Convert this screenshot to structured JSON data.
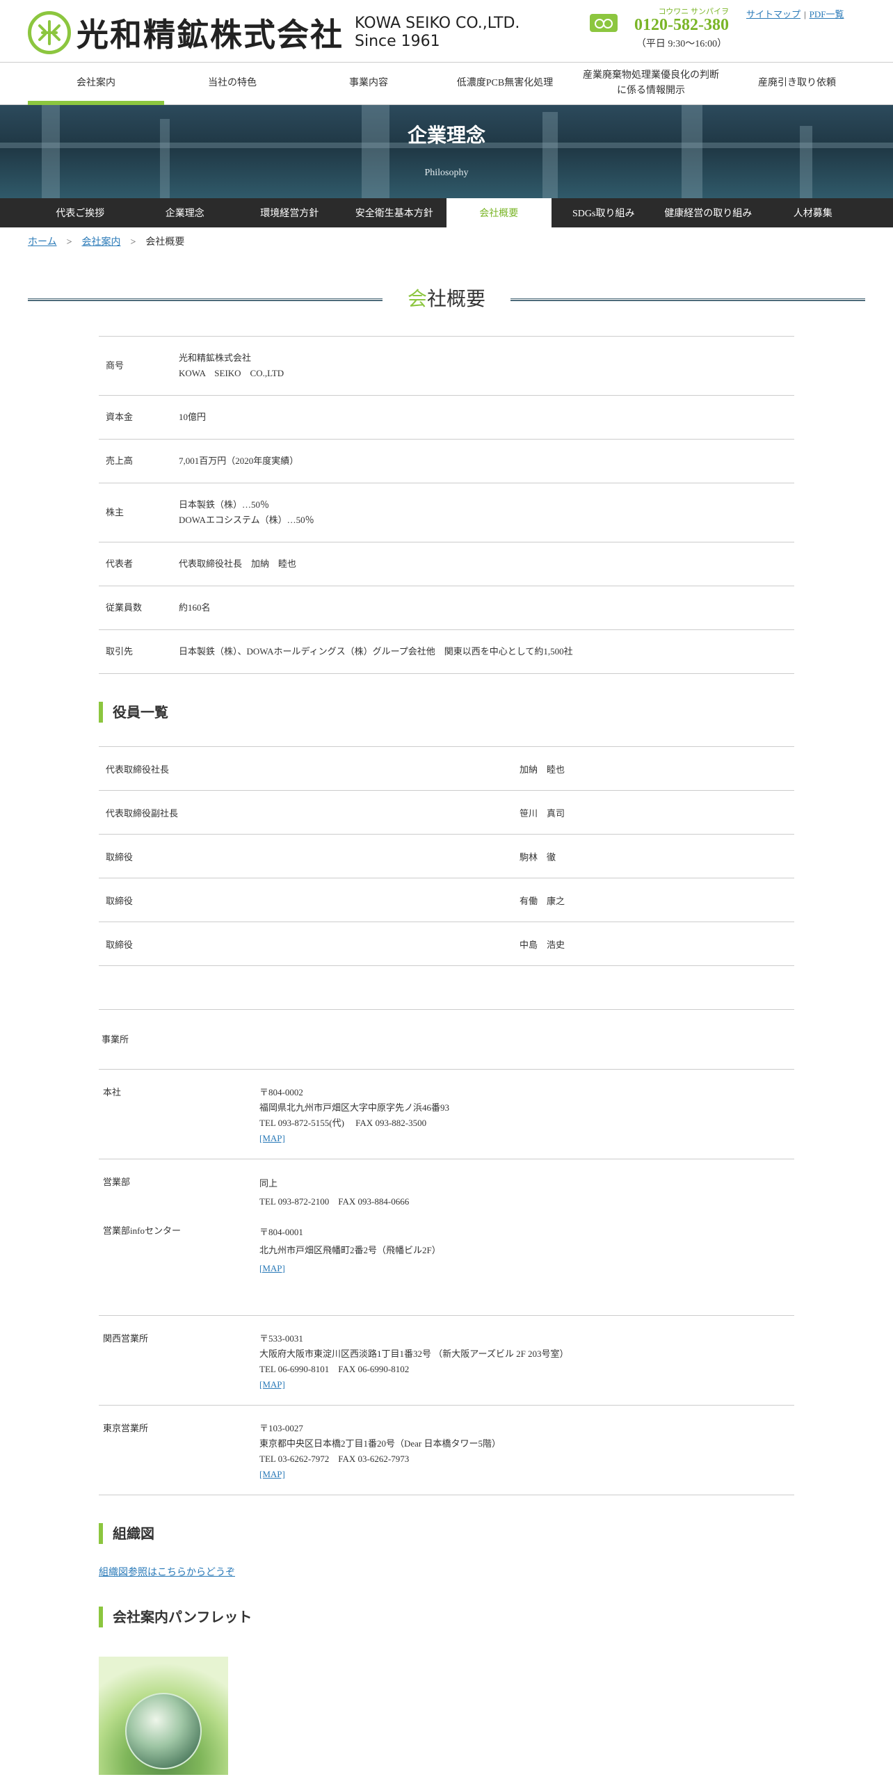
{
  "header": {
    "logo_name": "光和精鉱株式会社",
    "logo_en_line1": "KOWA SEIKO CO.,LTD.",
    "logo_en_line2": "Since 1961",
    "phone_kana": "コウワニ サンパイヲ",
    "phone_number": "0120-582-380",
    "phone_hours": "（平日 9:30〜16:00）",
    "sitemap_link": "サイトマップ",
    "pdf_link": "PDF一覧"
  },
  "gnav": {
    "items": [
      {
        "label": "会社案内"
      },
      {
        "label": "当社の特色"
      },
      {
        "label": "事業内容"
      },
      {
        "label": "低濃度PCB無害化処理"
      },
      {
        "label": "産業廃棄物処理業優良化の判断に係る情報開示"
      },
      {
        "label": "産廃引き取り依頼"
      }
    ]
  },
  "hero": {
    "title": "企業理念",
    "subtitle": "Philosophy"
  },
  "subnav": {
    "items": [
      {
        "label": "代表ご挨拶"
      },
      {
        "label": "企業理念"
      },
      {
        "label": "環境経営方針"
      },
      {
        "label": "安全衛生基本方針"
      },
      {
        "label": "会社概要"
      },
      {
        "label": "SDGs取り組み"
      },
      {
        "label": "健康経営の取り組み"
      },
      {
        "label": "人材募集"
      }
    ]
  },
  "breadcrumb": {
    "home": "ホーム",
    "company": "会社案内",
    "current": "会社概要",
    "separator": ">"
  },
  "page": {
    "title_accent": "会",
    "title_rest": "社概要"
  },
  "company_info": [
    {
      "label": "商号",
      "lines": [
        "光和精鉱株式会社",
        "KOWA　SEIKO　CO.,LTD"
      ]
    },
    {
      "label": "資本金",
      "lines": [
        "10億円"
      ]
    },
    {
      "label": "売上高",
      "lines": [
        "7,001百万円（2020年度実績）"
      ]
    },
    {
      "label": "株主",
      "lines": [
        "日本製鉄（株）…50％",
        "DOWAエコシステム（株）…50％"
      ]
    },
    {
      "label": "代表者",
      "lines": [
        "代表取締役社長　加納　睦也"
      ]
    },
    {
      "label": "従業員数",
      "lines": [
        "約160名"
      ]
    },
    {
      "label": "取引先",
      "lines": [
        "日本製鉄（株）、DOWAホールディングス（株）グループ会社他　関東以西を中心として約1,500社"
      ]
    }
  ],
  "officers": {
    "title": "役員一覧",
    "rows": [
      {
        "role": "代表取締役社長",
        "name": "加納　睦也"
      },
      {
        "role": "代表取締役副社長",
        "name": "笹川　真司"
      },
      {
        "role": "取締役",
        "name": "駒林　徹"
      },
      {
        "role": "取締役",
        "name": "有働　康之"
      },
      {
        "role": "取締役",
        "name": "中島　浩史"
      }
    ]
  },
  "offices": {
    "header": "事業所",
    "map_label": "[MAP]",
    "head_office": {
      "name": "本社",
      "postal": "〒804-0002",
      "address": "福岡県北九州市戸畑区大字中原字先ノ浜46番93",
      "tel": "TEL 093-872-5155(代)　 FAX 093-882-3500"
    },
    "sales": {
      "name": "営業部",
      "line1": "同上",
      "tel": "TEL 093-872-2100　FAX 093-884-0666"
    },
    "info_center": {
      "name": "営業部infoセンター",
      "postal": "〒804-0001",
      "address": "北九州市戸畑区飛幡町2番2号（飛幡ビル2F）"
    },
    "kansai": {
      "name": "関西営業所",
      "postal": "〒533-0031",
      "address": "大阪府大阪市東淀川区西淡路1丁目1番32号 （新大阪アーズビル 2F 203号室）",
      "tel": "TEL 06-6990-8101　FAX 06-6990-8102"
    },
    "tokyo": {
      "name": "東京営業所",
      "postal": "〒103-0027",
      "address": "東京都中央区日本橋2丁目1番20号（Dear 日本橋タワー5階）",
      "tel": "TEL 03-6262-7972　FAX 03-6262-7973"
    }
  },
  "org": {
    "title": "組織図",
    "link": "組織図参照はこちらからどうぞ"
  },
  "pamphlet": {
    "title": "会社案内パンフレット"
  },
  "colors": {
    "accent": "#8cc63f",
    "subnav_bg": "#2b2b2b",
    "link": "#2a7ab8"
  }
}
